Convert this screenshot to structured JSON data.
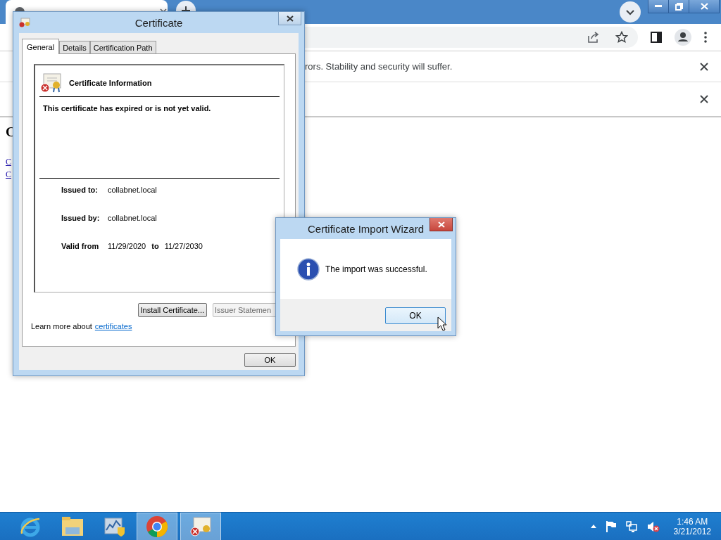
{
  "browser": {
    "infobars": [
      {
        "message": "rors. Stability and security will suffer."
      },
      {
        "kind": "empty"
      }
    ]
  },
  "page": {
    "heading": "C",
    "links": [
      "C",
      "C"
    ]
  },
  "certificate_dialog": {
    "title": "Certificate",
    "tabs": [
      {
        "label": "General",
        "selected": true
      },
      {
        "label": "Details",
        "selected": false
      },
      {
        "label": "Certification Path",
        "selected": false
      }
    ],
    "header": "Certificate Information",
    "status": "This certificate has expired or is not yet valid.",
    "fields": [
      {
        "label": "Issued to:",
        "value": "collabnet.local"
      },
      {
        "label": "Issued by:",
        "value": "collabnet.local"
      }
    ],
    "validity": {
      "label": "Valid from",
      "from": "11/29/2020",
      "to_label": "to",
      "to": "11/27/2030"
    },
    "buttons": [
      {
        "label": "Install Certificate...",
        "disabled": false
      },
      {
        "label": "Issuer Statemen",
        "disabled": true
      }
    ],
    "learn_more": {
      "text": "Learn more about",
      "link": "certificates"
    },
    "ok": "OK"
  },
  "wizard": {
    "title": "Certificate Import Wizard",
    "message": "The import was successful.",
    "ok": "OK"
  },
  "taskbar": {
    "apps": [
      {
        "kind": "ie",
        "active": false
      },
      {
        "kind": "explorer",
        "active": false
      },
      {
        "kind": "tool",
        "active": false
      },
      {
        "kind": "chrome",
        "active": true
      },
      {
        "kind": "certificate",
        "active": true
      }
    ],
    "clock": {
      "time": "1:46 AM",
      "date": "3/21/2012"
    }
  }
}
